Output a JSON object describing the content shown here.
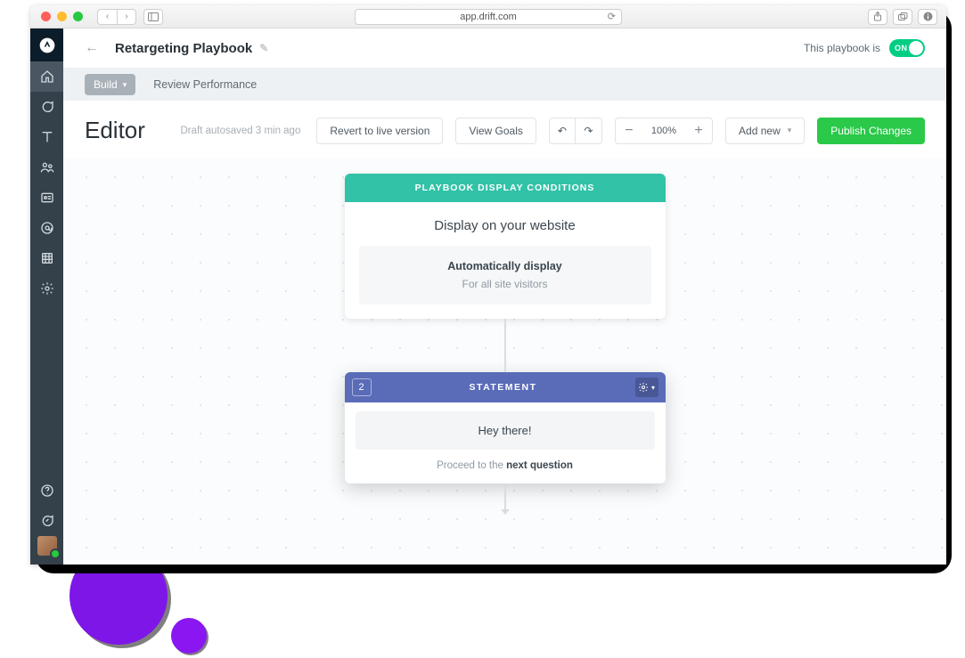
{
  "browser": {
    "url": "app.drift.com"
  },
  "header": {
    "title": "Retargeting Playbook",
    "status_label": "This playbook is",
    "toggle_state": "ON"
  },
  "subheader": {
    "build_label": "Build",
    "review_label": "Review Performance"
  },
  "toolbar": {
    "editor_title": "Editor",
    "autosave_text": "Draft autosaved 3 min ago",
    "revert_label": "Revert to live version",
    "view_goals_label": "View Goals",
    "zoom_value": "100%",
    "add_new_label": "Add new",
    "publish_label": "Publish Changes"
  },
  "conditions_card": {
    "header_label": "PLAYBOOK DISPLAY CONDITIONS",
    "title": "Display on your website",
    "inner_title": "Automatically display",
    "inner_subtitle": "For all site visitors"
  },
  "statement_card": {
    "number": "2",
    "header_label": "STATEMENT",
    "message": "Hey there!",
    "proceed_prefix": "Proceed to the ",
    "proceed_bold": "next question"
  }
}
